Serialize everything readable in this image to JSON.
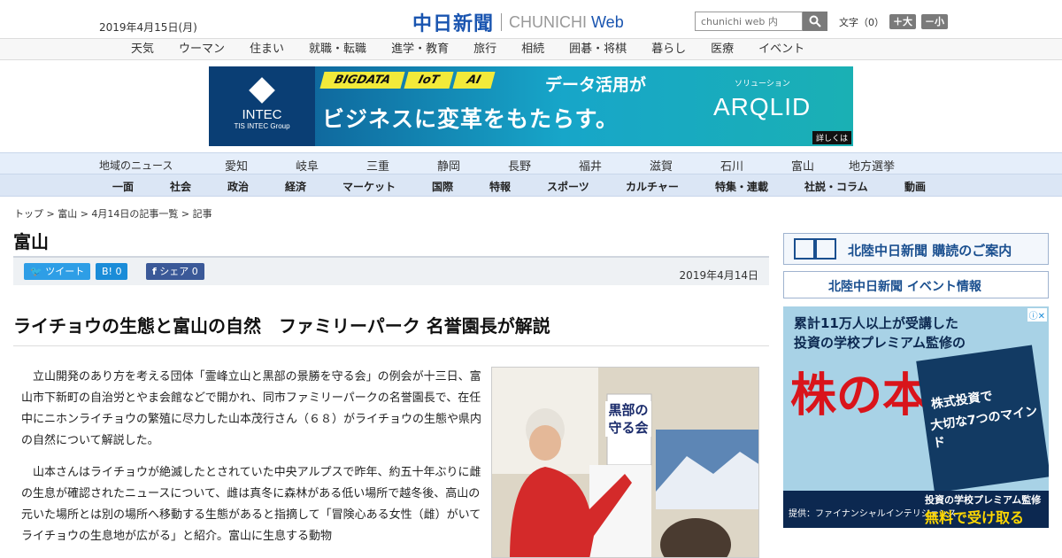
{
  "header": {
    "date": "2019年4月15日(月)",
    "logo_kanji": "中日新聞",
    "logo_en": "CHUNICHI",
    "logo_web": "Web",
    "search_placeholder": "chunichi web 内",
    "font_label": "文字（0）",
    "font_plus": "＋大",
    "font_minus": "－小"
  },
  "category_nav": [
    "天気",
    "ウーマン",
    "住まい",
    "就職・転職",
    "進学・教育",
    "旅行",
    "相続",
    "囲碁・将棋",
    "暮らし",
    "医療",
    "イベント"
  ],
  "banner_ad": {
    "brand": "INTEC",
    "brand_sub": "TIS INTEC Group",
    "tags": [
      "BIGDATA",
      "IoT",
      "AI"
    ],
    "line1": "データ活用が",
    "line2": "ビジネスに変革をもたらす。",
    "solution_label": "ソリューション",
    "product": "ARQLID",
    "more": "詳しくは"
  },
  "regional_nav": {
    "label": "地域のニュース",
    "items": [
      "愛知",
      "岐阜",
      "三重",
      "静岡",
      "長野",
      "福井",
      "滋賀",
      "石川",
      "富山",
      "地方選挙"
    ]
  },
  "main_nav": [
    "一面",
    "社会",
    "政治",
    "経済",
    "マーケット",
    "国際",
    "特報",
    "スポーツ",
    "カルチャー",
    "特集・連載",
    "社説・コラム",
    "動画"
  ],
  "breadcrumb": "トップ > 富山 > 4月14日の記事一覧 > 記事",
  "section_title": "富山",
  "share": {
    "tweet": "ツイート",
    "hatena": "B! 0",
    "facebook": "シェア 0"
  },
  "publish_date": "2019年4月14日",
  "article": {
    "headline": "ライチョウの生態と富山の自然　ファミリーパーク 名誉園長が解説",
    "paragraphs": [
      "立山開発のあり方を考える団体「霊峰立山と黒部の景勝を守る会」の例会が十三日、富山市下新町の自治労とやま会館などで開かれ、同市ファミリーパークの名誉園長で、在任中にニホンライチョウの繁殖に尽力した山本茂行さん（６８）がライチョウの生態や県内の自然について解説した。",
      "山本さんはライチョウが絶滅したとされていた中央アルプスで昨年、約五十年ぶりに雌の生息が確認されたニュースについて、雌は真冬に森林がある低い場所で越冬後、高山の元いた場所とは別の場所へ移動する生態があると指摘して「冒険心ある女性（雌）がいてライチョウの生息地が広がる」と紹介。富山に生息する動物"
    ],
    "photo_sign": "黒部の守る会"
  },
  "sidebar": {
    "subscribe": "北陸中日新聞 購読のご案内",
    "event": "北陸中日新聞 イベント情報",
    "ad": {
      "line1": "累計11万人以上が受講した",
      "line2": "投資の学校プレミアム監修の",
      "big": "株の本",
      "book_line1": "株式投資で",
      "book_line2": "大切な7つのマインド",
      "provider": "提供：ファイナンシャルインテリジェンス",
      "footer1": "投資の学校プレミアム監修",
      "footer2": "無料で受け取る"
    }
  }
}
